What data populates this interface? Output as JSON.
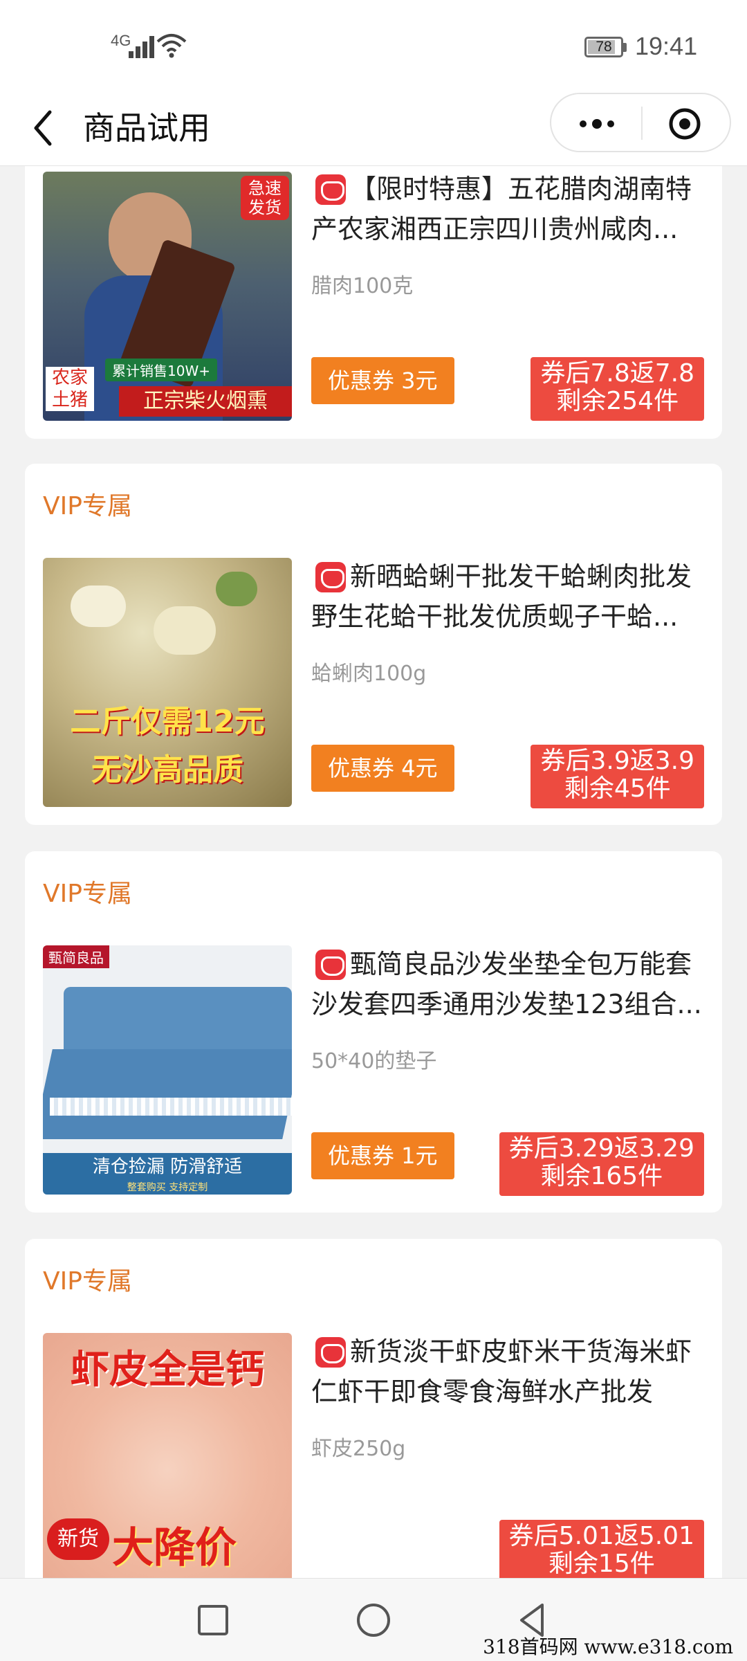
{
  "status_bar": {
    "network": "4G",
    "battery": "78",
    "battery_level": 0.78,
    "time": "19:41"
  },
  "nav": {
    "title": "商品试用"
  },
  "products": [
    {
      "vip_label": "",
      "badge_icon": "pinduoduo-icon",
      "title": "【限时特惠】五花腊肉湖南特产农家湘西正宗四川贵州咸肉...",
      "spec": "腊肉100克",
      "coupon": "优惠券  3元",
      "price_line1": "券后7.8返7.8",
      "price_line2": "剩余254件",
      "image": {
        "corner_badge": "急速发货",
        "sales_text": "累计销售10W+",
        "left_tag": "农家土猪",
        "banner": "正宗柴火烟熏"
      }
    },
    {
      "vip_label": "VIP专属",
      "badge_icon": "pinduoduo-icon",
      "title": "新晒蛤蜊干批发干蛤蜊肉批发野生花蛤干批发优质蚬子干蛤...",
      "spec": "蛤蜊肉100g",
      "coupon": "优惠券  4元",
      "price_line1": "券后3.9返3.9",
      "price_line2": "剩余45件",
      "image": {
        "line1": "二斤仅需12元",
        "line2": "无沙高品质"
      }
    },
    {
      "vip_label": "VIP专属",
      "badge_icon": "pinduoduo-icon",
      "title": "甄简良品沙发坐垫全包万能套沙发套四季通用沙发垫123组合...",
      "spec": "50*40的垫子",
      "coupon": "优惠券  1元",
      "price_line1": "券后3.29返3.29",
      "price_line2": "剩余165件",
      "image": {
        "brand": "甄简良品",
        "banner": "清仓捡漏  防滑舒适",
        "sub": "整套购买 支持定制"
      }
    },
    {
      "vip_label": "VIP专属",
      "badge_icon": "pinduoduo-icon",
      "title": "新货淡干虾皮虾米干货海米虾仁虾干即食零食海鲜水产批发",
      "spec": "虾皮250g",
      "coupon": "",
      "price_line1": "券后5.01返5.01",
      "price_line2": "剩余15件",
      "image": {
        "top_text": "虾皮全是钙",
        "new_tag": "新货",
        "banner": "大降价"
      }
    }
  ],
  "watermark": "318首码网  www.e318.com",
  "colors": {
    "accent_orange": "#f28020",
    "price_red": "#ed4b40",
    "vip_text": "#e0782a",
    "badge_red": "#e8333a"
  }
}
